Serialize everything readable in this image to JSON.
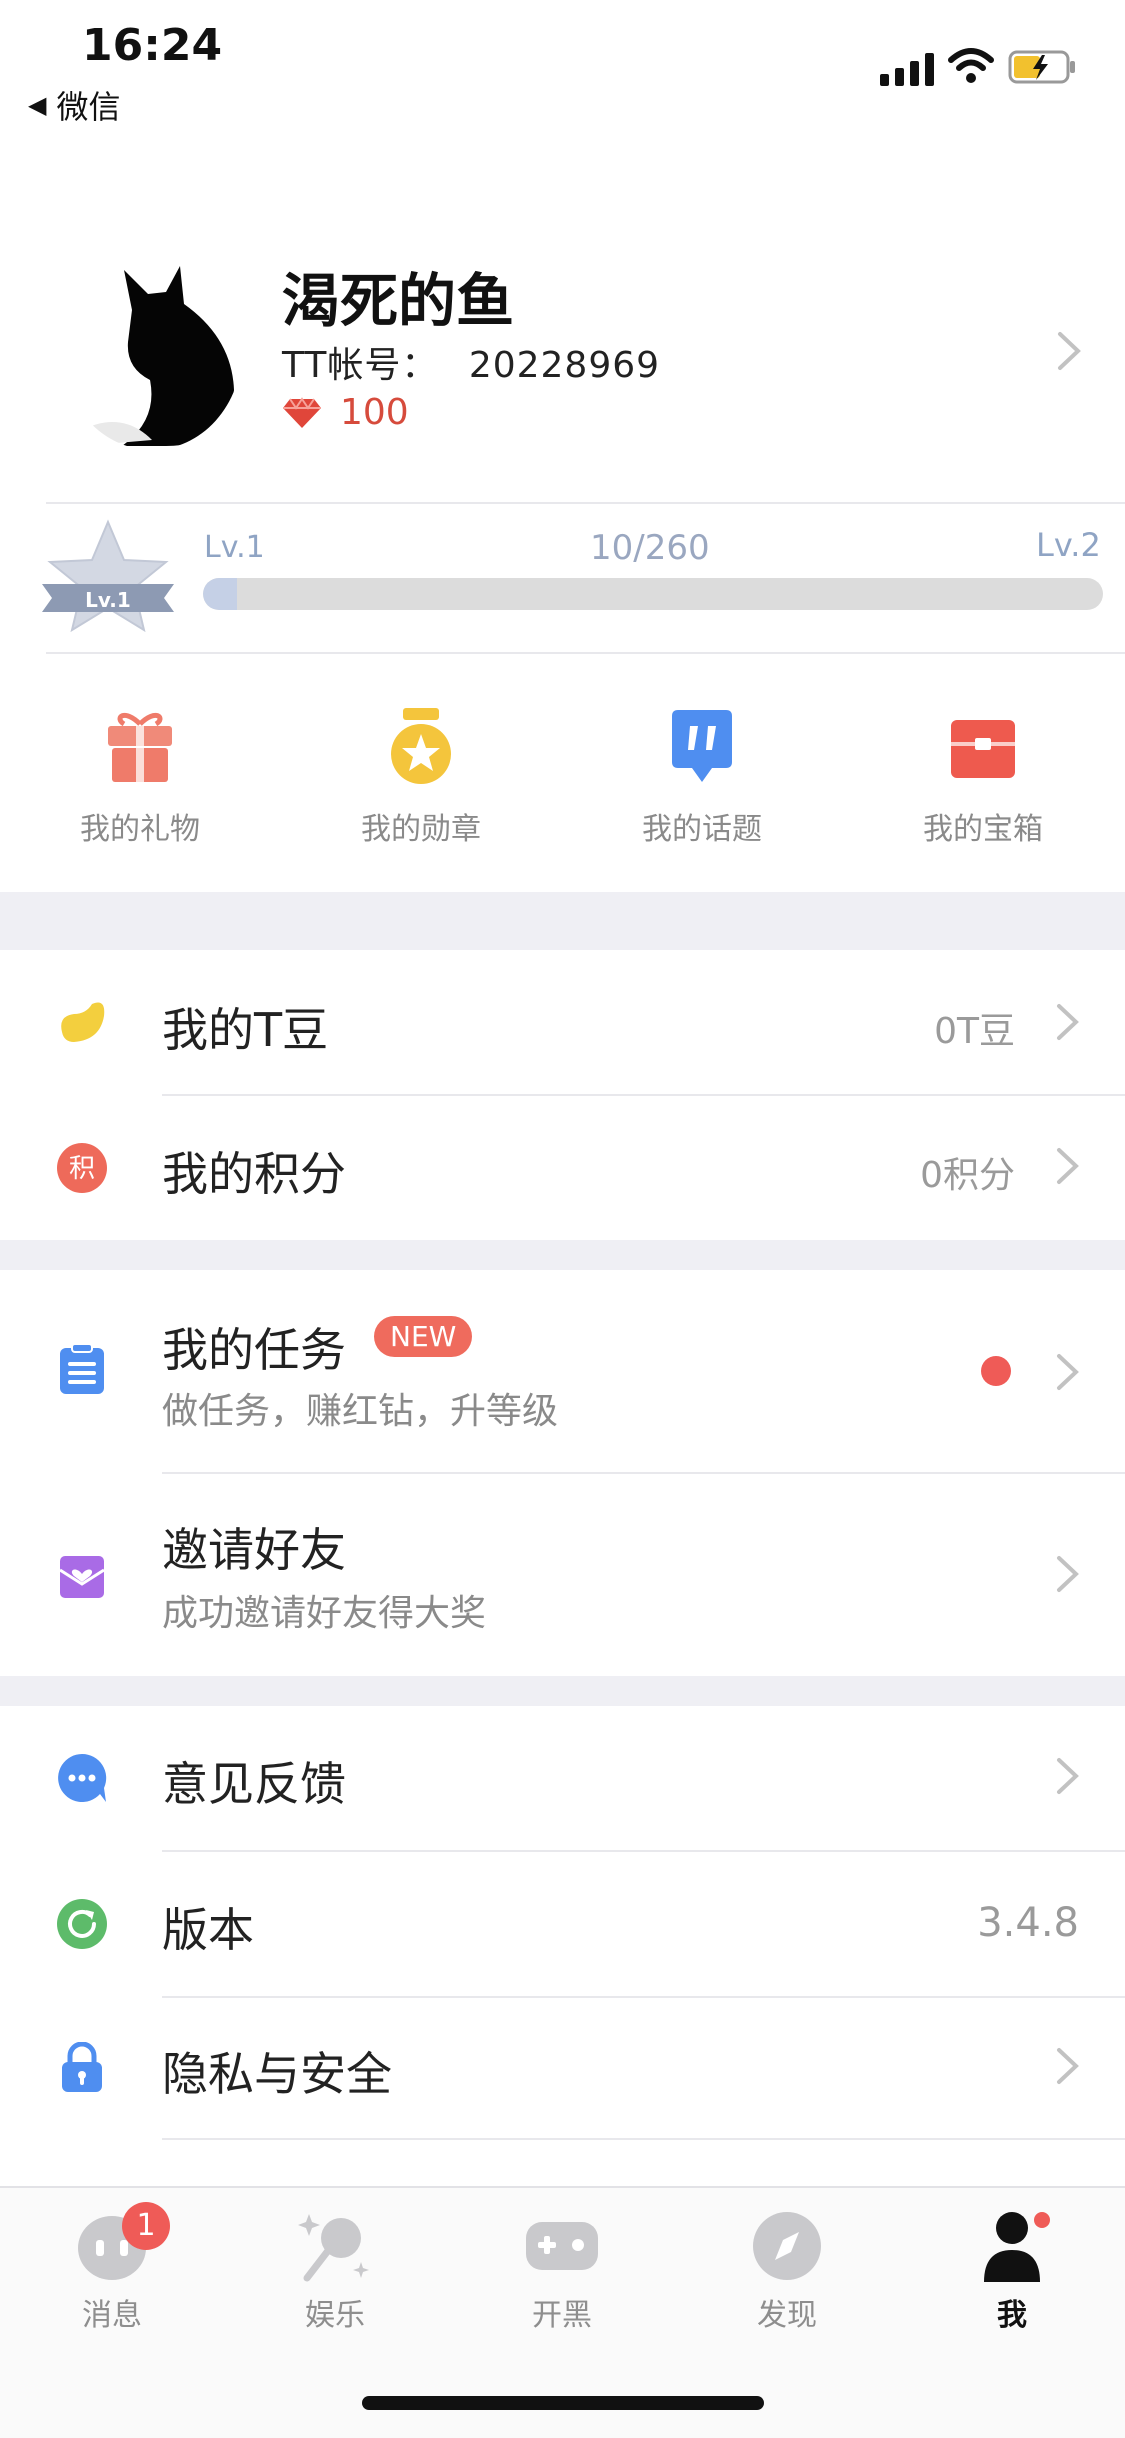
{
  "status_bar": {
    "time": "16:24",
    "back_label": "微信"
  },
  "profile": {
    "name": "渴死的鱼",
    "tt_label": "TT帐号：",
    "tt_id": "20228969",
    "diamond_count": "100"
  },
  "level": {
    "current_label": "Lv.1",
    "next_label": "Lv.2",
    "badge_label": "Lv.1",
    "progress_text": "10/260",
    "progress_fraction": 0.038
  },
  "quick_actions": [
    {
      "label": "我的礼物"
    },
    {
      "label": "我的勋章"
    },
    {
      "label": "我的话题"
    },
    {
      "label": "我的宝箱"
    }
  ],
  "rows": {
    "tdou": {
      "title": "我的T豆",
      "value": "0T豆"
    },
    "points": {
      "title": "我的积分",
      "value": "0积分",
      "icon_text": "积"
    },
    "tasks": {
      "title": "我的任务",
      "badge": "NEW",
      "subtitle": "做任务，赚红钻，升等级"
    },
    "invite": {
      "title": "邀请好友",
      "subtitle": "成功邀请好友得大奖"
    },
    "feedback": {
      "title": "意见反馈"
    },
    "version": {
      "title": "版本",
      "value": "3.4.8"
    },
    "privacy": {
      "title": "隐私与安全"
    }
  },
  "tabs": [
    {
      "label": "消息",
      "badge": "1"
    },
    {
      "label": "娱乐"
    },
    {
      "label": "开黑"
    },
    {
      "label": "发现"
    },
    {
      "label": "我"
    }
  ],
  "colors": {
    "accent_red": "#ef5b57",
    "diamond_red": "#d64b3c",
    "divider": "#efeff4"
  }
}
